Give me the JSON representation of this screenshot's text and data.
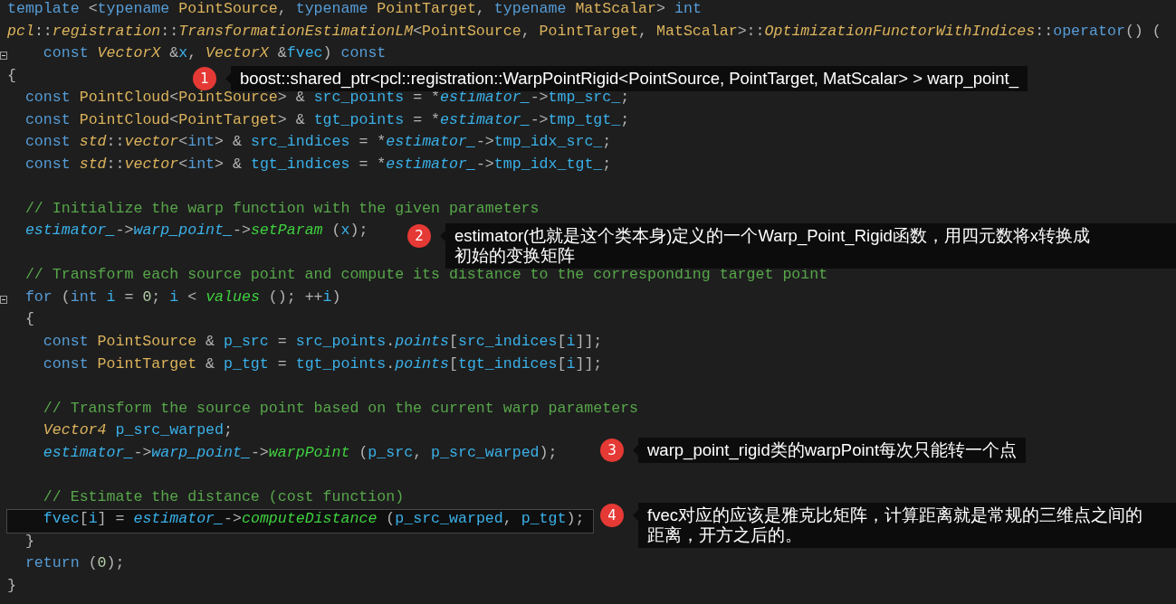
{
  "lines": [
    {
      "fold": false,
      "current": false,
      "tokens": [
        {
          "kind": "kw",
          "text": "template"
        },
        {
          "kind": "p",
          "text": " <"
        },
        {
          "kind": "kw",
          "text": "typename"
        },
        {
          "kind": "type",
          "text": " PointSource"
        },
        {
          "kind": "p",
          "text": ", "
        },
        {
          "kind": "kw",
          "text": "typename"
        },
        {
          "kind": "type",
          "text": " PointTarget"
        },
        {
          "kind": "p",
          "text": ", "
        },
        {
          "kind": "kw",
          "text": "typename"
        },
        {
          "kind": "type",
          "text": " MatScalar"
        },
        {
          "kind": "p",
          "text": "> "
        },
        {
          "kind": "kw",
          "text": "int"
        }
      ]
    },
    {
      "fold": false,
      "current": false,
      "tokens": [
        {
          "kind": "type-i",
          "text": "pcl"
        },
        {
          "kind": "p",
          "text": "::"
        },
        {
          "kind": "type-i",
          "text": "registration"
        },
        {
          "kind": "p",
          "text": "::"
        },
        {
          "kind": "type-i",
          "text": "TransformationEstimationLM"
        },
        {
          "kind": "p",
          "text": "<"
        },
        {
          "kind": "type",
          "text": "PointSource"
        },
        {
          "kind": "p",
          "text": ", "
        },
        {
          "kind": "type",
          "text": "PointTarget"
        },
        {
          "kind": "p",
          "text": ", "
        },
        {
          "kind": "type",
          "text": "MatScalar"
        },
        {
          "kind": "p",
          "text": ">::"
        },
        {
          "kind": "type-i",
          "text": "OptimizationFunctorWithIndices"
        },
        {
          "kind": "p",
          "text": "::"
        },
        {
          "kind": "kw",
          "text": "operator"
        },
        {
          "kind": "p",
          "text": "() ("
        }
      ]
    },
    {
      "fold": true,
      "current": false,
      "tokens": [
        {
          "kind": "kw",
          "text": "    const"
        },
        {
          "kind": "type-i",
          "text": " VectorX"
        },
        {
          "kind": "p",
          "text": " &"
        },
        {
          "kind": "var",
          "text": "x"
        },
        {
          "kind": "p",
          "text": ", "
        },
        {
          "kind": "type-i",
          "text": "VectorX"
        },
        {
          "kind": "p",
          "text": " &"
        },
        {
          "kind": "var",
          "text": "fvec"
        },
        {
          "kind": "p",
          "text": ") "
        },
        {
          "kind": "kw",
          "text": "const"
        }
      ]
    },
    {
      "fold": false,
      "current": false,
      "tokens": [
        {
          "kind": "p",
          "text": "{"
        }
      ]
    },
    {
      "fold": false,
      "current": false,
      "tokens": [
        {
          "kind": "kw",
          "text": "  const"
        },
        {
          "kind": "type",
          "text": " PointCloud"
        },
        {
          "kind": "p",
          "text": "<"
        },
        {
          "kind": "type",
          "text": "PointSource"
        },
        {
          "kind": "p",
          "text": "> & "
        },
        {
          "kind": "var",
          "text": "src_points"
        },
        {
          "kind": "p",
          "text": " = *"
        },
        {
          "kind": "var-i",
          "text": "estimator_"
        },
        {
          "kind": "p",
          "text": "->"
        },
        {
          "kind": "var",
          "text": "tmp_src_"
        },
        {
          "kind": "p",
          "text": ";"
        }
      ]
    },
    {
      "fold": false,
      "current": false,
      "tokens": [
        {
          "kind": "kw",
          "text": "  const"
        },
        {
          "kind": "type",
          "text": " PointCloud"
        },
        {
          "kind": "p",
          "text": "<"
        },
        {
          "kind": "type",
          "text": "PointTarget"
        },
        {
          "kind": "p",
          "text": "> & "
        },
        {
          "kind": "var",
          "text": "tgt_points"
        },
        {
          "kind": "p",
          "text": " = *"
        },
        {
          "kind": "var-i",
          "text": "estimator_"
        },
        {
          "kind": "p",
          "text": "->"
        },
        {
          "kind": "var",
          "text": "tmp_tgt_"
        },
        {
          "kind": "p",
          "text": ";"
        }
      ]
    },
    {
      "fold": false,
      "current": false,
      "tokens": [
        {
          "kind": "kw",
          "text": "  const"
        },
        {
          "kind": "type-i",
          "text": " std"
        },
        {
          "kind": "p",
          "text": "::"
        },
        {
          "kind": "type-i",
          "text": "vector"
        },
        {
          "kind": "p",
          "text": "<"
        },
        {
          "kind": "kw",
          "text": "int"
        },
        {
          "kind": "p",
          "text": "> & "
        },
        {
          "kind": "var",
          "text": "src_indices"
        },
        {
          "kind": "p",
          "text": " = *"
        },
        {
          "kind": "var-i",
          "text": "estimator_"
        },
        {
          "kind": "p",
          "text": "->"
        },
        {
          "kind": "var",
          "text": "tmp_idx_src_"
        },
        {
          "kind": "p",
          "text": ";"
        }
      ]
    },
    {
      "fold": false,
      "current": false,
      "tokens": [
        {
          "kind": "kw",
          "text": "  const"
        },
        {
          "kind": "type-i",
          "text": " std"
        },
        {
          "kind": "p",
          "text": "::"
        },
        {
          "kind": "type-i",
          "text": "vector"
        },
        {
          "kind": "p",
          "text": "<"
        },
        {
          "kind": "kw",
          "text": "int"
        },
        {
          "kind": "p",
          "text": "> & "
        },
        {
          "kind": "var",
          "text": "tgt_indices"
        },
        {
          "kind": "p",
          "text": " = *"
        },
        {
          "kind": "var-i",
          "text": "estimator_"
        },
        {
          "kind": "p",
          "text": "->"
        },
        {
          "kind": "var",
          "text": "tmp_idx_tgt_"
        },
        {
          "kind": "p",
          "text": ";"
        }
      ]
    },
    {
      "fold": false,
      "current": false
    },
    {
      "fold": false,
      "current": false,
      "tokens": [
        {
          "kind": "cm",
          "text": "  // Initialize the warp function with the given parameters"
        }
      ]
    },
    {
      "fold": false,
      "current": false,
      "tokens": [
        {
          "kind": "var-i",
          "text": "  estimator_"
        },
        {
          "kind": "p",
          "text": "->"
        },
        {
          "kind": "var-i",
          "text": "warp_point_"
        },
        {
          "kind": "p",
          "text": "->"
        },
        {
          "kind": "fn-i",
          "text": "setParam"
        },
        {
          "kind": "p",
          "text": " ("
        },
        {
          "kind": "var",
          "text": "x"
        },
        {
          "kind": "p",
          "text": ");"
        }
      ]
    },
    {
      "fold": false,
      "current": false
    },
    {
      "fold": false,
      "current": false,
      "tokens": [
        {
          "kind": "cm",
          "text": "  // Transform each source point and compute its distance to the corresponding target point"
        }
      ]
    },
    {
      "fold": true,
      "current": false,
      "tokens": [
        {
          "kind": "kw",
          "text": "  for"
        },
        {
          "kind": "p",
          "text": " ("
        },
        {
          "kind": "kw",
          "text": "int"
        },
        {
          "kind": "var",
          "text": " i"
        },
        {
          "kind": "p",
          "text": " = "
        },
        {
          "kind": "num",
          "text": "0"
        },
        {
          "kind": "p",
          "text": "; "
        },
        {
          "kind": "var",
          "text": "i"
        },
        {
          "kind": "p",
          "text": " < "
        },
        {
          "kind": "fn-i",
          "text": "values"
        },
        {
          "kind": "p",
          "text": " (); ++"
        },
        {
          "kind": "var",
          "text": "i"
        },
        {
          "kind": "p",
          "text": ")"
        }
      ]
    },
    {
      "fold": false,
      "current": false,
      "tokens": [
        {
          "kind": "p",
          "text": "  {"
        }
      ]
    },
    {
      "fold": false,
      "current": false,
      "tokens": [
        {
          "kind": "kw",
          "text": "    const"
        },
        {
          "kind": "type",
          "text": " PointSource"
        },
        {
          "kind": "p",
          "text": " & "
        },
        {
          "kind": "var",
          "text": "p_src"
        },
        {
          "kind": "p",
          "text": " = "
        },
        {
          "kind": "var",
          "text": "src_points"
        },
        {
          "kind": "p",
          "text": "."
        },
        {
          "kind": "var-i",
          "text": "points"
        },
        {
          "kind": "p",
          "text": "["
        },
        {
          "kind": "var",
          "text": "src_indices"
        },
        {
          "kind": "p",
          "text": "["
        },
        {
          "kind": "var",
          "text": "i"
        },
        {
          "kind": "p",
          "text": "]];"
        }
      ]
    },
    {
      "fold": false,
      "current": false,
      "tokens": [
        {
          "kind": "kw",
          "text": "    const"
        },
        {
          "kind": "type",
          "text": " PointTarget"
        },
        {
          "kind": "p",
          "text": " & "
        },
        {
          "kind": "var",
          "text": "p_tgt"
        },
        {
          "kind": "p",
          "text": " = "
        },
        {
          "kind": "var",
          "text": "tgt_points"
        },
        {
          "kind": "p",
          "text": "."
        },
        {
          "kind": "var-i",
          "text": "points"
        },
        {
          "kind": "p",
          "text": "["
        },
        {
          "kind": "var",
          "text": "tgt_indices"
        },
        {
          "kind": "p",
          "text": "["
        },
        {
          "kind": "var",
          "text": "i"
        },
        {
          "kind": "p",
          "text": "]];"
        }
      ]
    },
    {
      "fold": false,
      "current": false
    },
    {
      "fold": false,
      "current": false,
      "tokens": [
        {
          "kind": "cm",
          "text": "    // Transform the source point based on the current warp parameters"
        }
      ]
    },
    {
      "fold": false,
      "current": false,
      "tokens": [
        {
          "kind": "type-i",
          "text": "    Vector4"
        },
        {
          "kind": "var",
          "text": " p_src_warped"
        },
        {
          "kind": "p",
          "text": ";"
        }
      ]
    },
    {
      "fold": false,
      "current": false,
      "tokens": [
        {
          "kind": "var-i",
          "text": "    estimator_"
        },
        {
          "kind": "p",
          "text": "->"
        },
        {
          "kind": "var-i",
          "text": "warp_point_"
        },
        {
          "kind": "p",
          "text": "->"
        },
        {
          "kind": "fn-i",
          "text": "warpPoint"
        },
        {
          "kind": "p",
          "text": " ("
        },
        {
          "kind": "var",
          "text": "p_src"
        },
        {
          "kind": "p",
          "text": ", "
        },
        {
          "kind": "var",
          "text": "p_src_warped"
        },
        {
          "kind": "p",
          "text": ");"
        }
      ]
    },
    {
      "fold": false,
      "current": false
    },
    {
      "fold": false,
      "current": false,
      "tokens": [
        {
          "kind": "cm",
          "text": "    // Estimate the distance (cost function)"
        }
      ]
    },
    {
      "fold": false,
      "current": true,
      "tokens": [
        {
          "kind": "var",
          "text": "    fvec"
        },
        {
          "kind": "p",
          "text": "["
        },
        {
          "kind": "var",
          "text": "i"
        },
        {
          "kind": "p",
          "text": "] = "
        },
        {
          "kind": "var-i",
          "text": "estimator_"
        },
        {
          "kind": "p",
          "text": "->"
        },
        {
          "kind": "fn-i",
          "text": "computeDistance"
        },
        {
          "kind": "p",
          "text": " ("
        },
        {
          "kind": "var",
          "text": "p_src_warped"
        },
        {
          "kind": "p",
          "text": ", "
        },
        {
          "kind": "var",
          "text": "p_tgt"
        },
        {
          "kind": "p",
          "text": ");"
        }
      ]
    },
    {
      "fold": false,
      "current": false,
      "tokens": [
        {
          "kind": "p",
          "text": "  }"
        }
      ]
    },
    {
      "fold": false,
      "current": false,
      "tokens": [
        {
          "kind": "kw",
          "text": "  return"
        },
        {
          "kind": "p",
          "text": " ("
        },
        {
          "kind": "num",
          "text": "0"
        },
        {
          "kind": "p",
          "text": ");"
        }
      ]
    },
    {
      "fold": false,
      "current": false,
      "tokens": [
        {
          "kind": "p",
          "text": "}"
        }
      ]
    }
  ],
  "annotations": [
    {
      "number": "1",
      "text": "boost::shared_ptr<pcl::registration::WarpPointRigid<PointSource, PointTarget, MatScalar> > warp_point_"
    },
    {
      "number": "2",
      "text": "estimator(也就是这个类本身)定义的一个Warp_Point_Rigid函数，用四元数将x转换成初始的变换矩阵"
    },
    {
      "number": "3",
      "text": "warp_point_rigid类的warpPoint每次只能转一个点"
    },
    {
      "number": "4",
      "text": "fvec对应的应该是雅克比矩阵，计算距离就是常规的三维点之间的距离，开方之后的。"
    }
  ]
}
